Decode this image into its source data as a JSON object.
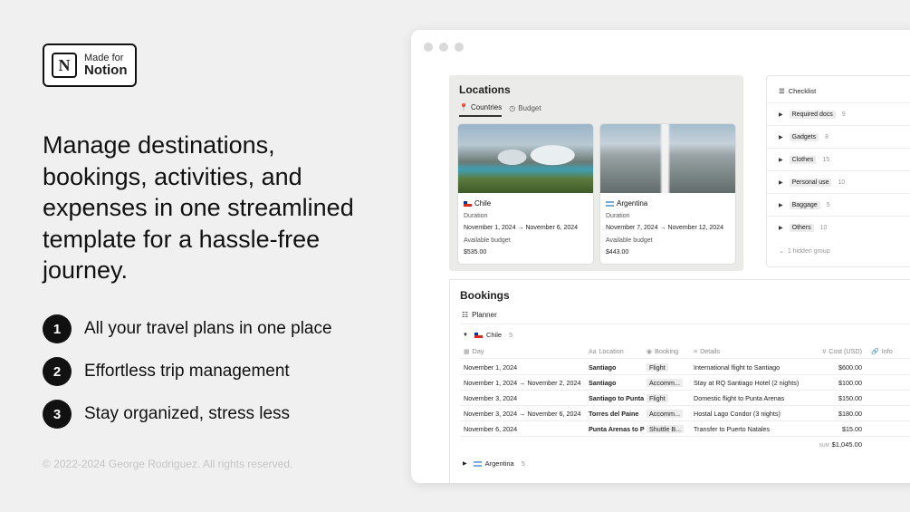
{
  "badge": {
    "logo": "N",
    "made_for": "Made for",
    "brand": "Notion"
  },
  "headline": "Manage destinations, bookings, activities, and expenses in one streamlined template for a hassle-free journey.",
  "features": [
    {
      "num": "1",
      "text": "All your travel plans in one place"
    },
    {
      "num": "2",
      "text": "Effortless trip management"
    },
    {
      "num": "3",
      "text": "Stay organized, stress less"
    }
  ],
  "copyright": "© 2022-2024 George Rodriguez. All rights reserved.",
  "locations": {
    "title": "Locations",
    "tabs": [
      {
        "label": "Countries",
        "icon": "pin-icon",
        "active": true
      },
      {
        "label": "Budget",
        "icon": "clock-icon",
        "active": false
      }
    ],
    "cards": [
      {
        "country": "Chile",
        "duration_label": "Duration",
        "duration": "November 1, 2024 → November 6, 2024",
        "budget_label": "Available budget",
        "budget": "$535.00"
      },
      {
        "country": "Argentina",
        "duration_label": "Duration",
        "duration": "November 7, 2024 → November 12, 2024",
        "budget_label": "Available budget",
        "budget": "$443.00"
      }
    ]
  },
  "checklist": {
    "title": "Checklist",
    "groups": [
      {
        "label": "Required docs",
        "count": "9"
      },
      {
        "label": "Gadgets",
        "count": "8"
      },
      {
        "label": "Clothes",
        "count": "15"
      },
      {
        "label": "Personal use",
        "count": "10"
      },
      {
        "label": "Baggage",
        "count": "5"
      },
      {
        "label": "Others",
        "count": "10"
      }
    ],
    "hidden": "1 hidden group"
  },
  "bookings": {
    "title": "Bookings",
    "view": "Planner",
    "columns": [
      "Day",
      "Location",
      "Booking",
      "Details",
      "Cost (USD)",
      "Info"
    ],
    "group1": {
      "name": "Chile",
      "count": "5"
    },
    "rows": [
      {
        "day": "November 1, 2024",
        "location": "Santiago",
        "booking": "Flight",
        "details": "International flight to Santiago",
        "cost": "$600.00"
      },
      {
        "day": "November 1, 2024 → November 2, 2024",
        "location": "Santiago",
        "booking": "Accomm...",
        "details": "Stay at RQ Santiago Hotel (2 nights)",
        "cost": "$100.00"
      },
      {
        "day": "November 3, 2024",
        "location": "Santiago to Punta",
        "booking": "Flight",
        "details": "Domestic flight to Punta Arenas",
        "cost": "$150.00"
      },
      {
        "day": "November 3, 2024 → November 6, 2024",
        "location": "Torres del Paine",
        "booking": "Accomm...",
        "details": "Hostal Lago Condor (3 nights)",
        "cost": "$180.00"
      },
      {
        "day": "November 6, 2024",
        "location": "Punta Arenas to P",
        "booking": "Shuttle B...",
        "details": "Transfer to Puerto Natales",
        "cost": "$15.00"
      }
    ],
    "sum_label": "SUM",
    "sum": "$1,045.00",
    "group2": {
      "name": "Argentina",
      "count": "5"
    }
  }
}
